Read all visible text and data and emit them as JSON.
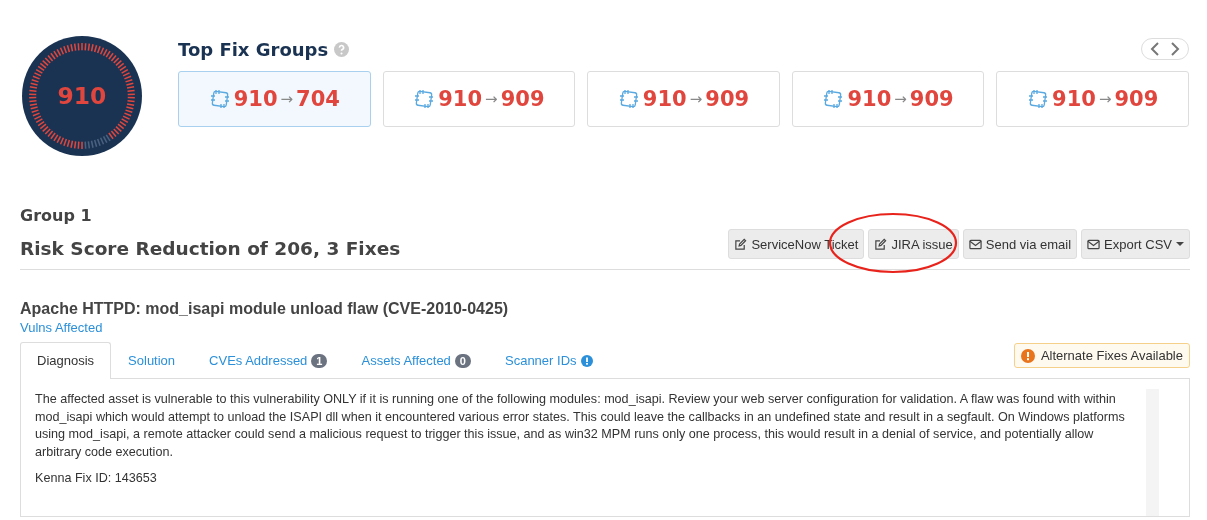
{
  "score": {
    "value": "910"
  },
  "fix_groups": {
    "title": "Top Fix Groups",
    "cards": [
      {
        "from": "910",
        "arrow": "→",
        "to": "704",
        "selected": true
      },
      {
        "from": "910",
        "arrow": "→",
        "to": "909",
        "selected": false
      },
      {
        "from": "910",
        "arrow": "→",
        "to": "909",
        "selected": false
      },
      {
        "from": "910",
        "arrow": "→",
        "to": "909",
        "selected": false
      },
      {
        "from": "910",
        "arrow": "→",
        "to": "909",
        "selected": false
      }
    ]
  },
  "group": {
    "label": "Group 1",
    "heading": "Risk Score Reduction of 206, 3 Fixes"
  },
  "actions": [
    {
      "kind": "edit",
      "label": "ServiceNow Ticket",
      "highlighted": false
    },
    {
      "kind": "edit",
      "label": "JIRA issue",
      "highlighted": true
    },
    {
      "kind": "mail",
      "label": "Send via email",
      "highlighted": false
    },
    {
      "kind": "mail-dropdown",
      "label": "Export CSV",
      "highlighted": false
    }
  ],
  "fix": {
    "title": "Apache HTTPD: mod_isapi module unload flaw (CVE-2010-0425)",
    "link": "Vulns Affected"
  },
  "tabs": [
    {
      "label": "Diagnosis",
      "selected": true
    },
    {
      "label": "Solution",
      "selected": false
    },
    {
      "label": "CVEs Addressed",
      "badge": "1",
      "selected": false
    },
    {
      "label": "Assets Affected",
      "badge": "0",
      "selected": false
    },
    {
      "label": "Scanner IDs",
      "info": true,
      "selected": false
    }
  ],
  "alert": "Alternate Fixes Available",
  "diagnosis": {
    "text": "The affected asset is vulnerable to this vulnerability ONLY if it is running one of the following modules: mod_isapi. Review your web server configuration for validation. A flaw was found with within mod_isapi which would attempt to unload the ISAPI dll when it encountered various error states. This could leave the callbacks in an undefined state and result in a segfault. On Windows platforms using mod_isapi, a remote attacker could send a malicious request to trigger this issue, and as win32 MPM runs only one process, this would result in a denial of service, and potentially allow arbitrary code execution.",
    "fix_id": "Kenna Fix ID: 143653"
  }
}
